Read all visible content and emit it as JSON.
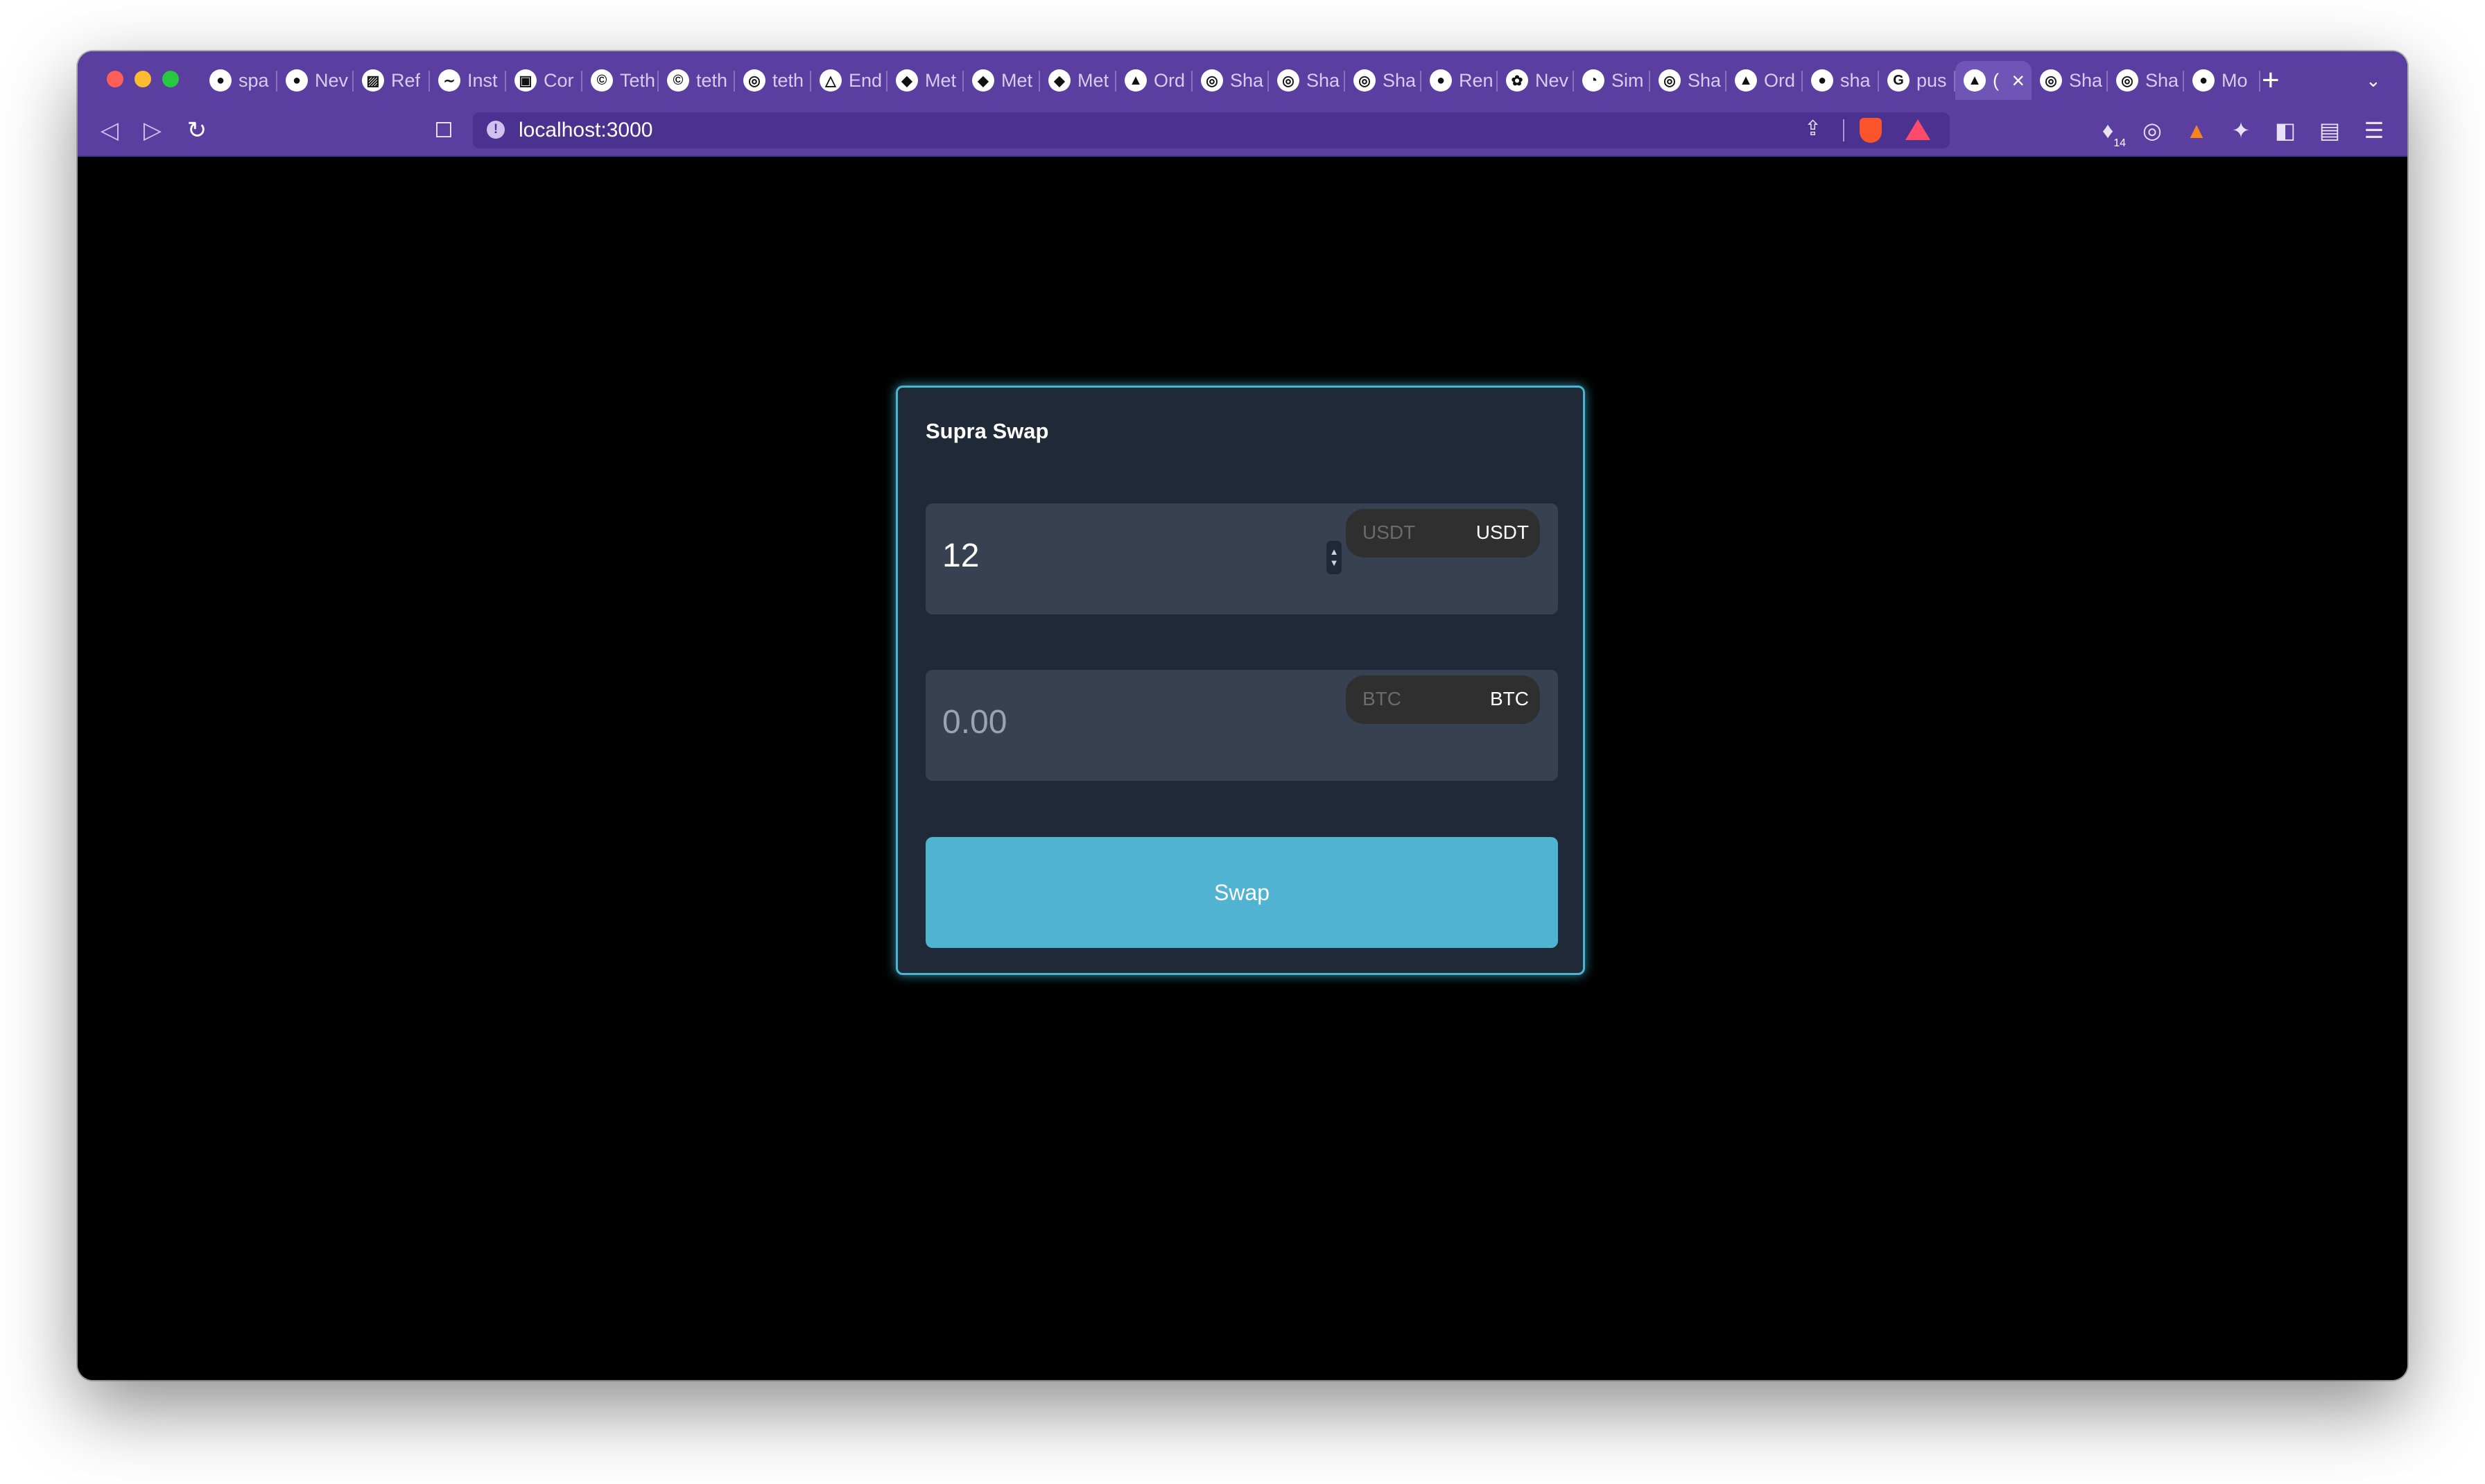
{
  "browser": {
    "tabs": [
      {
        "label": "spa",
        "icon": "github-icon"
      },
      {
        "label": "Nev",
        "icon": "github-icon"
      },
      {
        "label": "Ref",
        "icon": "chart-icon"
      },
      {
        "label": "Inst",
        "icon": "tailwind-icon"
      },
      {
        "label": "Cor",
        "icon": "app-icon"
      },
      {
        "label": "Teth",
        "icon": "coin-icon"
      },
      {
        "label": "teth",
        "icon": "coin-icon"
      },
      {
        "label": "teth",
        "icon": "globe-icon"
      },
      {
        "label": "End",
        "icon": "warning-icon"
      },
      {
        "label": "Met",
        "icon": "fox-icon"
      },
      {
        "label": "Met",
        "icon": "fox-icon"
      },
      {
        "label": "Met",
        "icon": "fox-icon"
      },
      {
        "label": "Ord",
        "icon": "triangle-icon"
      },
      {
        "label": "Sha",
        "icon": "globe-icon"
      },
      {
        "label": "Sha",
        "icon": "globe-icon"
      },
      {
        "label": "Sha",
        "icon": "globe-icon"
      },
      {
        "label": "Ren",
        "icon": "circle-icon"
      },
      {
        "label": "Nev",
        "icon": "openai-icon"
      },
      {
        "label": "Sim",
        "icon": "drop-icon"
      },
      {
        "label": "Sha",
        "icon": "globe-icon"
      },
      {
        "label": "Ord",
        "icon": "triangle-icon"
      },
      {
        "label": "sha",
        "icon": "github-icon"
      },
      {
        "label": "pus",
        "icon": "google-icon"
      },
      {
        "label": "(",
        "icon": "triangle-icon",
        "active": true
      },
      {
        "label": "Sha",
        "icon": "globe-icon"
      },
      {
        "label": "Sha",
        "icon": "globe-icon"
      },
      {
        "label": "Mo",
        "icon": "github-icon"
      }
    ],
    "new_tab": "+",
    "address": "localhost:3000",
    "extension_badge": "14"
  },
  "swap": {
    "title": "Supra Swap",
    "from": {
      "value": "12",
      "token_placeholder": "USDT",
      "token": "USDT"
    },
    "to": {
      "placeholder": "0.00",
      "token_placeholder": "BTC",
      "token": "BTC"
    },
    "button_label": "Swap"
  }
}
